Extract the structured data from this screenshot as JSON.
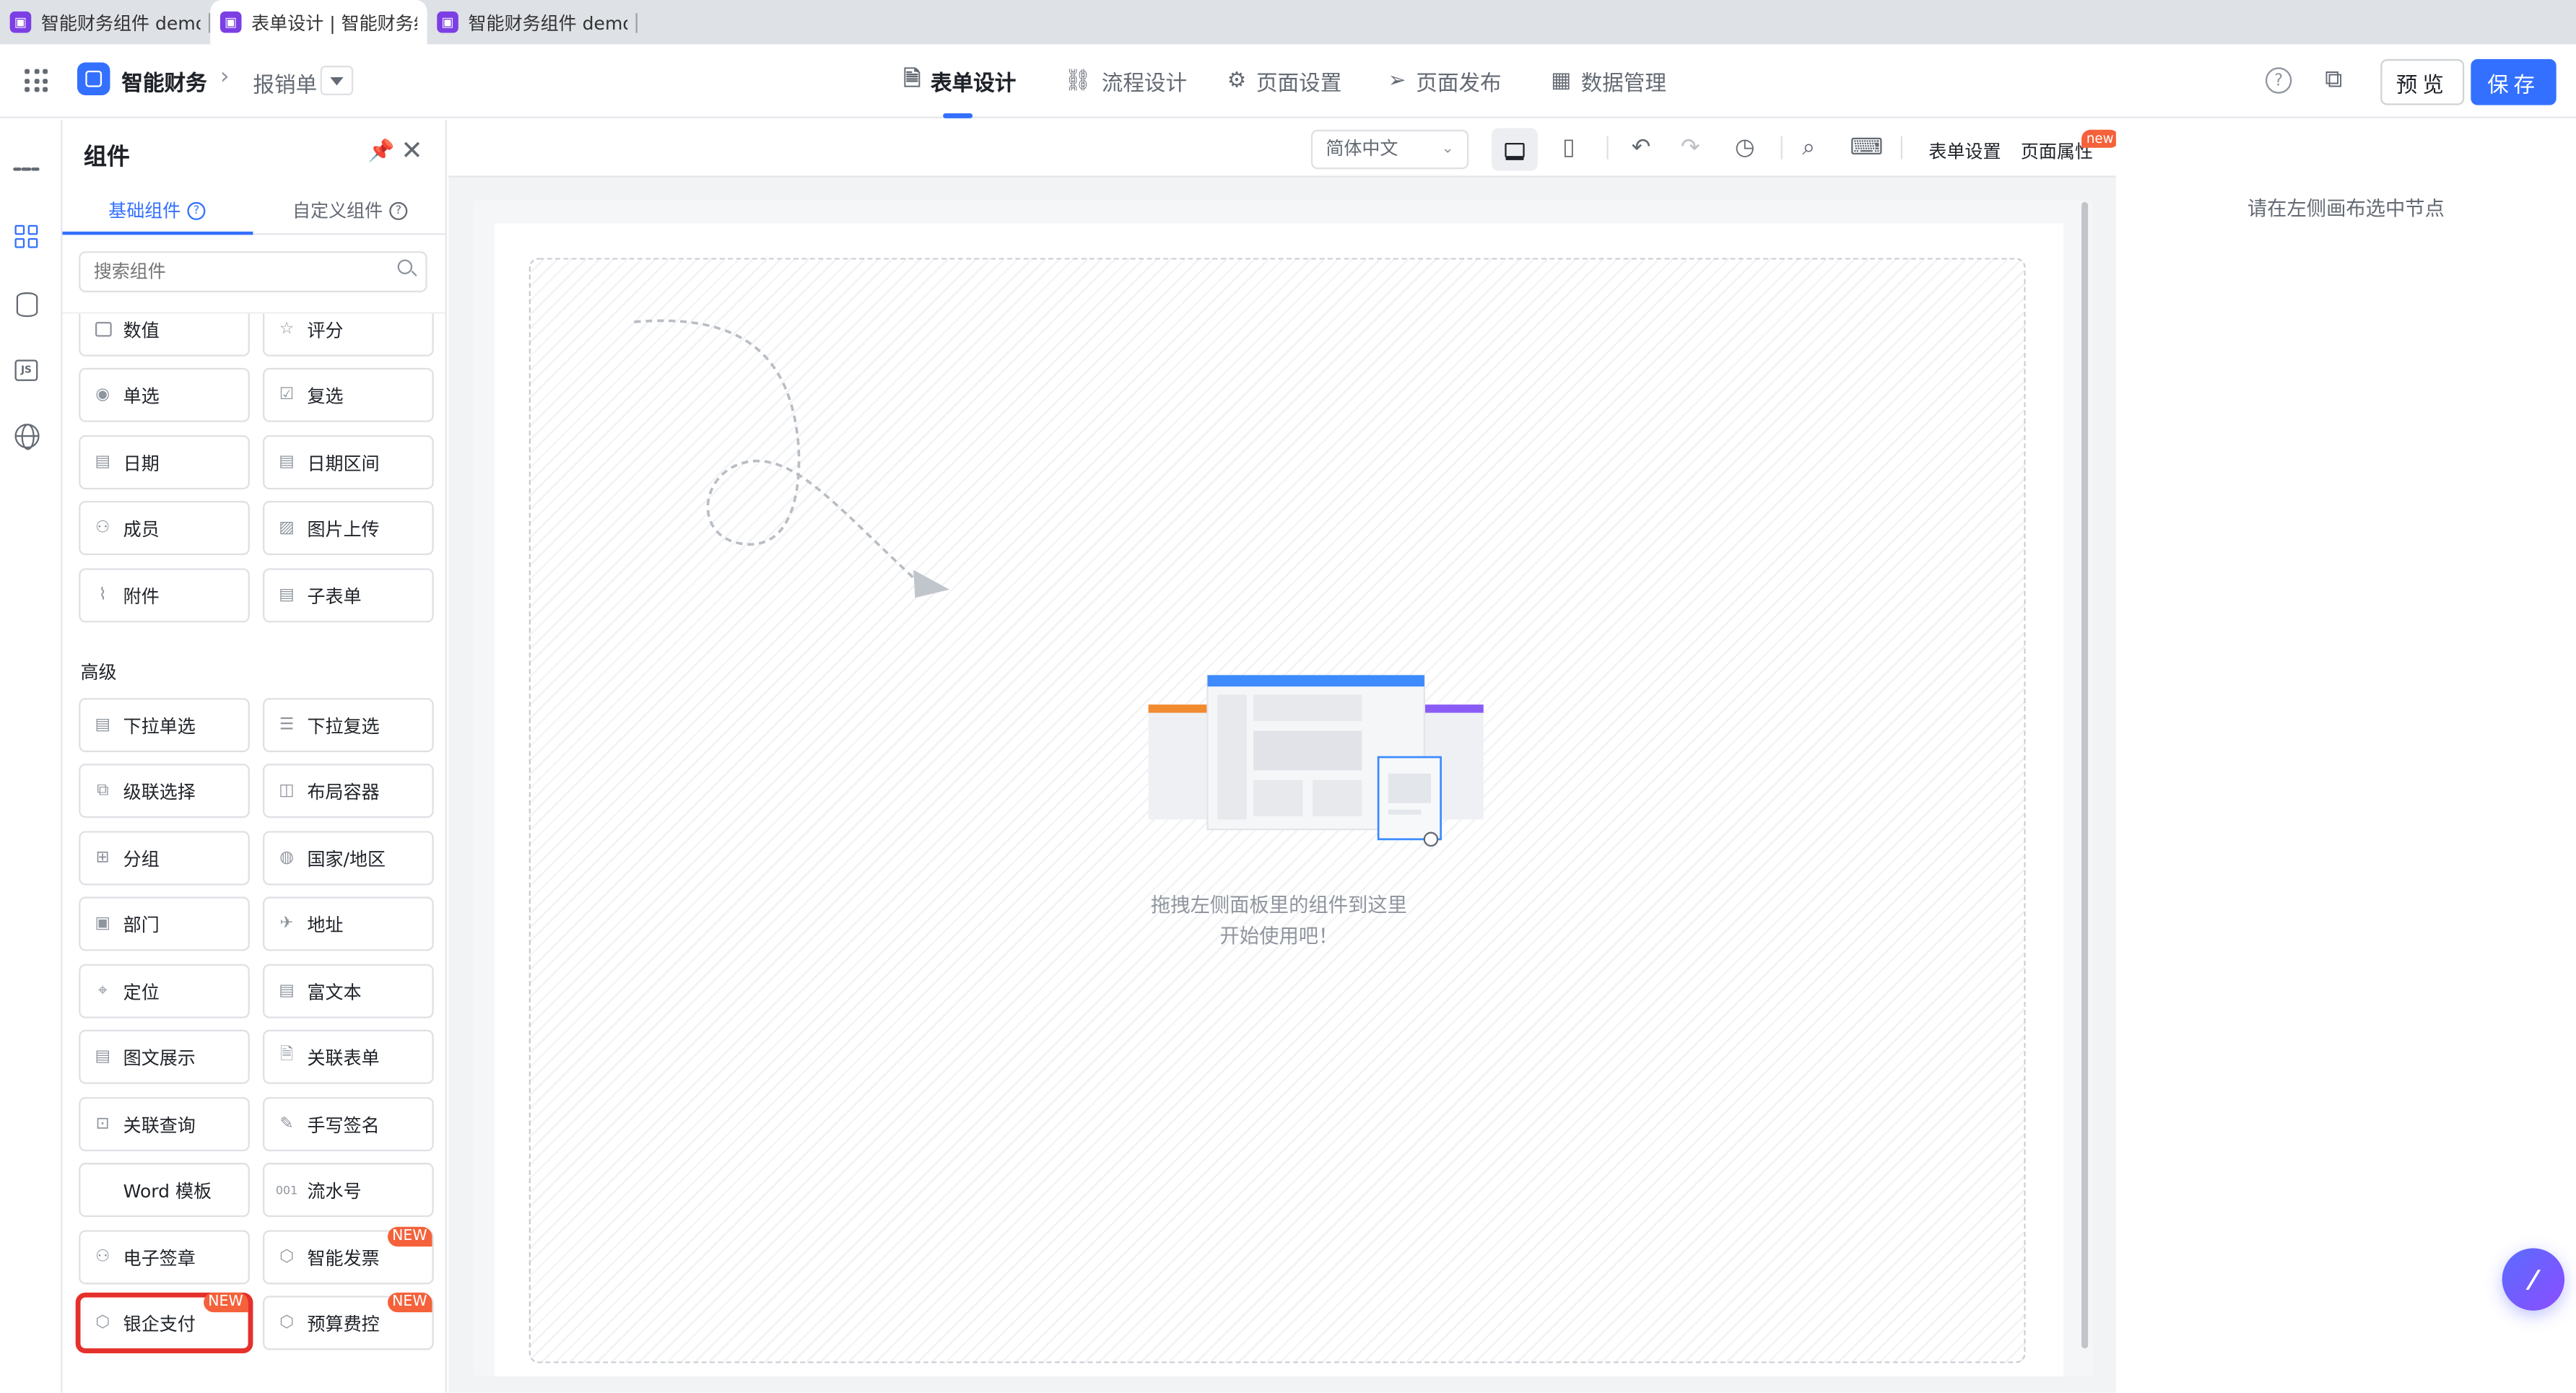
{
  "browser_tabs": [
    {
      "title": "智能财务组件 demo"
    },
    {
      "title": "表单设计 | 智能财务组"
    },
    {
      "title": "智能财务组件 demo"
    }
  ],
  "header": {
    "app_name": "智能财务",
    "breadcrumb": "报销单",
    "nav": [
      {
        "label": "表单设计",
        "icon": "doc-icon"
      },
      {
        "label": "流程设计",
        "icon": "flow-icon"
      },
      {
        "label": "页面设置",
        "icon": "gear-icon"
      },
      {
        "label": "页面发布",
        "icon": "send-icon"
      },
      {
        "label": "数据管理",
        "icon": "table-icon"
      }
    ],
    "active_nav": "表单设计",
    "preview_label": "预览",
    "save_label": "保存"
  },
  "panel": {
    "title": "组件",
    "tabs": [
      {
        "label": "基础组件"
      },
      {
        "label": "自定义组件"
      }
    ],
    "search_placeholder": "搜索组件",
    "section_advanced": "高级",
    "basic_items": [
      {
        "label": "数值",
        "icon": "number-icon"
      },
      {
        "label": "评分",
        "icon": "star-icon"
      },
      {
        "label": "单选",
        "icon": "radio-icon"
      },
      {
        "label": "复选",
        "icon": "checkbox-icon"
      },
      {
        "label": "日期",
        "icon": "calendar-icon"
      },
      {
        "label": "日期区间",
        "icon": "calendar-range-icon"
      },
      {
        "label": "成员",
        "icon": "user-icon"
      },
      {
        "label": "图片上传",
        "icon": "image-icon"
      },
      {
        "label": "附件",
        "icon": "paperclip-icon"
      },
      {
        "label": "子表单",
        "icon": "subform-icon"
      }
    ],
    "advanced_items": [
      {
        "label": "下拉单选",
        "icon": "dropdown-icon"
      },
      {
        "label": "下拉复选",
        "icon": "dropdown-multi-icon"
      },
      {
        "label": "级联选择",
        "icon": "cascade-icon"
      },
      {
        "label": "布局容器",
        "icon": "layout-icon"
      },
      {
        "label": "分组",
        "icon": "group-icon"
      },
      {
        "label": "国家/地区",
        "icon": "globe-icon"
      },
      {
        "label": "部门",
        "icon": "department-icon"
      },
      {
        "label": "地址",
        "icon": "map-icon"
      },
      {
        "label": "定位",
        "icon": "location-icon"
      },
      {
        "label": "富文本",
        "icon": "richtext-icon"
      },
      {
        "label": "图文展示",
        "icon": "media-icon"
      },
      {
        "label": "关联表单",
        "icon": "link-form-icon"
      },
      {
        "label": "关联查询",
        "icon": "query-icon"
      },
      {
        "label": "手写签名",
        "icon": "pen-icon"
      },
      {
        "label": "Word 模板",
        "icon": "word-icon"
      },
      {
        "label": "流水号",
        "icon": "serial-icon"
      },
      {
        "label": "电子签章",
        "icon": "seal-icon"
      },
      {
        "label": "智能发票",
        "icon": "puzzle-icon",
        "badge": "NEW"
      },
      {
        "label": "银企支付",
        "icon": "puzzle-icon",
        "badge": "NEW",
        "selected": true
      },
      {
        "label": "预算费控",
        "icon": "puzzle-icon",
        "badge": "NEW"
      }
    ]
  },
  "toolbar": {
    "language": "简体中文",
    "form_settings": "表单设置",
    "page_props": "页面属性",
    "page_props_badge": "new"
  },
  "canvas": {
    "empty_line1": "拖拽左侧面板里的组件到这里",
    "empty_line2": "开始使用吧！"
  },
  "props": {
    "hint": "请在左侧画布选中节点"
  },
  "colors": {
    "primary": "#3370ff",
    "badge": "#f5613a",
    "selected_outline": "#e5302b"
  }
}
